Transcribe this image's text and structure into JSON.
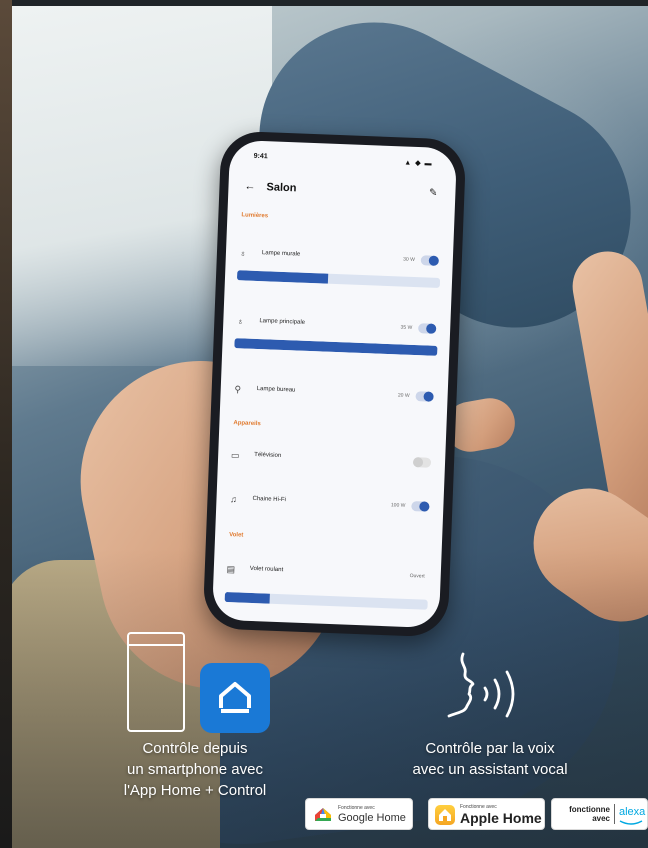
{
  "phone": {
    "status_time": "9:41",
    "status_icons": "▲ ◆ ▬",
    "title": "Salon",
    "sections": {
      "lumieres": "Lumières",
      "appareils": "Appareils",
      "volet": "Volet"
    },
    "devices": [
      {
        "label": "Lampe murale",
        "value": "30 W",
        "on": true,
        "slider": 0.45
      },
      {
        "label": "Lampe principale",
        "value": "35 W",
        "on": true,
        "slider": 1.0
      },
      {
        "label": "Lampe bureau",
        "value": "20 W",
        "on": true
      },
      {
        "label": "Télévision",
        "value": "",
        "on": false
      },
      {
        "label": "Chaine Hi-Fi",
        "value": "100 W",
        "on": true
      },
      {
        "label": "Volet roulant",
        "value": "Ouvert",
        "slider": 0.1
      }
    ]
  },
  "features": {
    "smartphone_caption": [
      "Contrôle depuis",
      "un smartphone avec",
      "l'App Home + Control"
    ],
    "voice_caption": [
      "Contrôle par la voix",
      "avec un assistant vocal"
    ]
  },
  "badges": {
    "google": {
      "small": "Fonctionne avec",
      "big": "Google Home"
    },
    "apple": {
      "small": "Fonctionne avec",
      "big": "Apple Home"
    },
    "alexa": {
      "left": "fonctionne",
      "left2": "avec",
      "right": "alexa"
    }
  },
  "colors": {
    "accent": "#1a79d6",
    "section": "#e07a2e",
    "toggle_on": "#2d5bb0"
  },
  "icons": [
    "smartphone-outline-icon",
    "home-app-icon",
    "voice-speaking-icon",
    "google-home-icon",
    "apple-home-icon"
  ]
}
